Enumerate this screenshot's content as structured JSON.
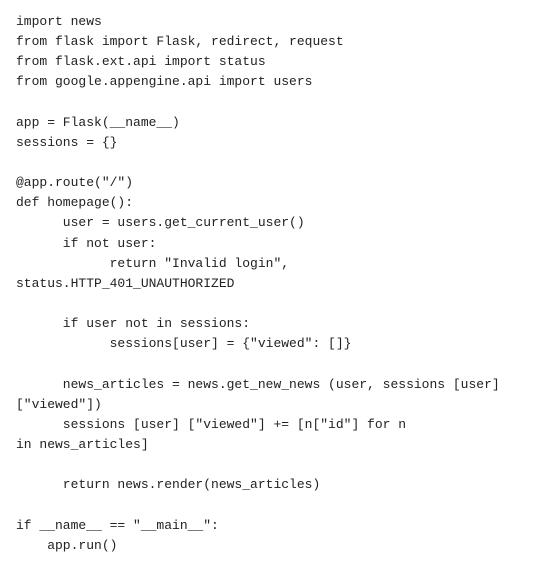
{
  "code": {
    "lines": [
      "import news",
      "from flask import Flask, redirect, request",
      "from flask.ext.api import status",
      "from google.appengine.api import users",
      "",
      "app = Flask(__name__)",
      "sessions = {}",
      "",
      "@app.route(\"/\")",
      "def homepage():",
      "      user = users.get_current_user()",
      "      if not user:",
      "            return \"Invalid login\",",
      "status.HTTP_401_UNAUTHORIZED",
      "",
      "      if user not in sessions:",
      "            sessions[user] = {\"viewed\": []}",
      "",
      "      news_articles = news.get_new_news (user, sessions [user]",
      "[\"viewed\"])",
      "      sessions [user] [\"viewed\"] += [n[\"id\"] for n",
      "in news_articles]",
      "",
      "      return news.render(news_articles)",
      "",
      "if __name__ == \"__main__\":",
      "    app.run()"
    ]
  }
}
